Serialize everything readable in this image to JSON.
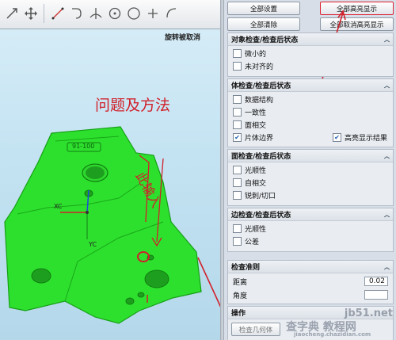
{
  "toolbar": {
    "icons": [
      "slash-arrow-icon",
      "move-cross-icon",
      "line-icon",
      "curve-icon",
      "perpendicular-icon",
      "circle-point-icon",
      "circle-icon",
      "plus-icon",
      "arc-icon"
    ]
  },
  "viewport": {
    "status": "旋转被取消",
    "annotation_title": "问题及方法",
    "annotation_vertical": "此输入",
    "part_label": "91-100",
    "axis_x": "XC",
    "axis_y": "YC",
    "part_color": "#2ee02e",
    "annotation_color": "#d0202a"
  },
  "panel": {
    "top_buttons": {
      "all_settings": "全部设置",
      "all_highlight": "全部高亮显示",
      "all_clear": "全部清除",
      "all_unhighlight": "全部取消高亮显示"
    },
    "object_check": {
      "title": "对象检查/检查后状态",
      "items": [
        {
          "label": "微小的",
          "checked": false
        },
        {
          "label": "未对齐的",
          "checked": false
        }
      ]
    },
    "body_check": {
      "title": "体检查/检查后状态",
      "items": [
        {
          "label": "数据结构",
          "checked": false
        },
        {
          "label": "一致性",
          "checked": false
        },
        {
          "label": "面相交",
          "checked": false
        },
        {
          "label": "片体边界",
          "checked": true
        }
      ],
      "highlight_results": {
        "label": "高亮显示结果",
        "checked": true
      }
    },
    "face_check": {
      "title": "面检查/检查后状态",
      "items": [
        {
          "label": "光顺性",
          "checked": false
        },
        {
          "label": "自相交",
          "checked": false
        },
        {
          "label": "锐刺/切口",
          "checked": false
        }
      ]
    },
    "edge_check": {
      "title": "边检查/检查后状态",
      "items": [
        {
          "label": "光顺性",
          "checked": false
        },
        {
          "label": "公差",
          "checked": false
        }
      ]
    },
    "criteria": {
      "title": "检查准则",
      "distance_label": "距离",
      "distance_value": "0.02",
      "angle_label": "角度",
      "angle_value": ""
    },
    "operation": {
      "title": "操作",
      "check_geometry": "检查几何体"
    }
  },
  "watermarks": {
    "site1": "jb51.net",
    "site2": "查字典 教程网",
    "site3": "jiaocheng.chazidian.com"
  }
}
